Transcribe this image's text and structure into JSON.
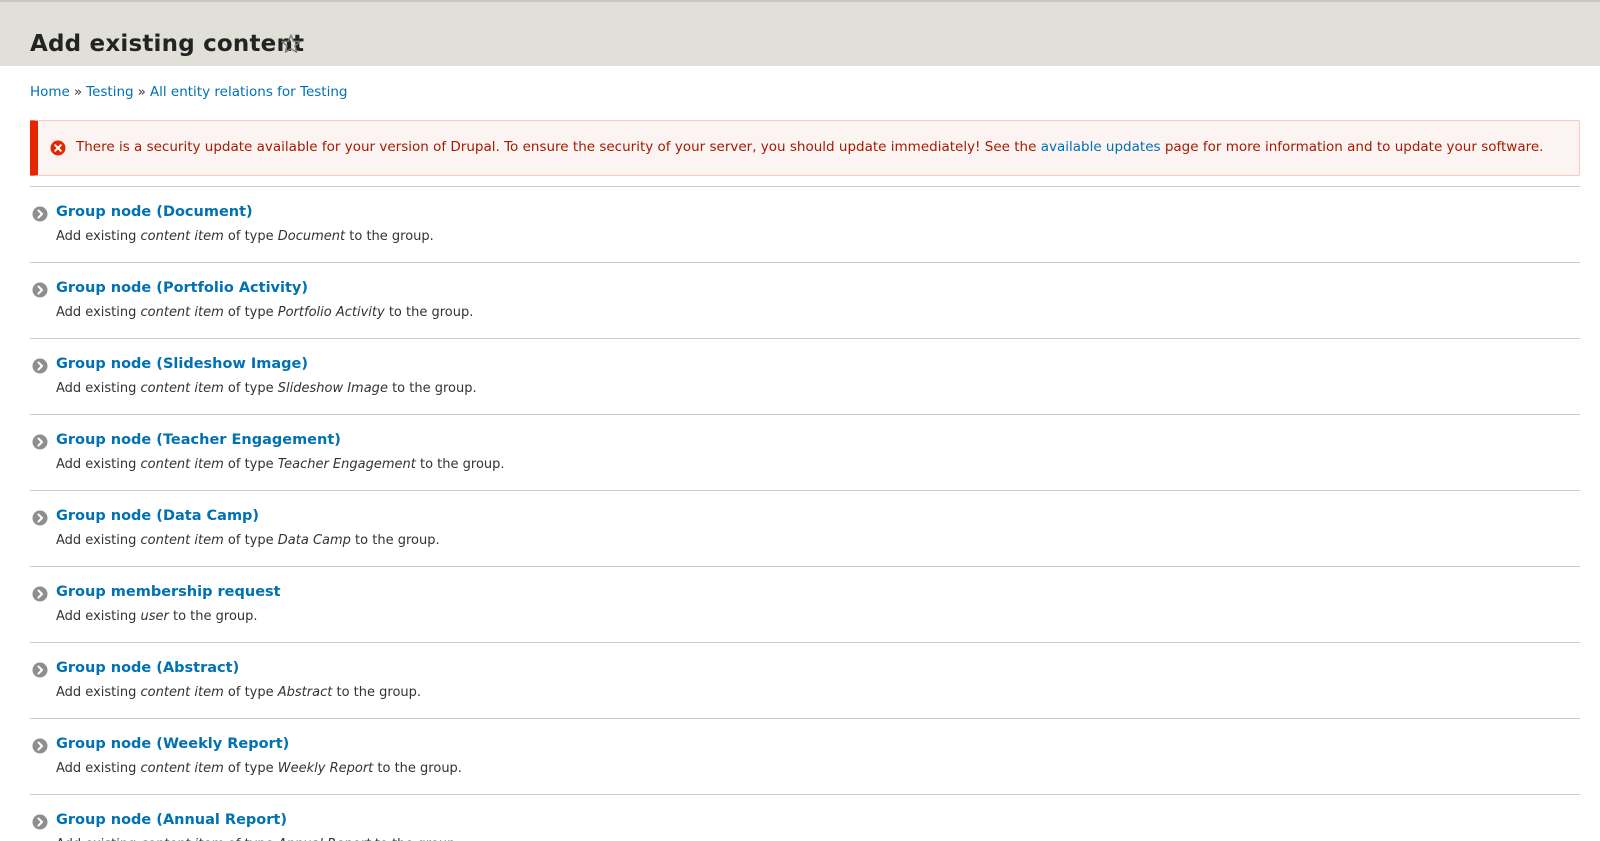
{
  "header": {
    "title": "Add existing content"
  },
  "breadcrumb": {
    "items": [
      "Home",
      "Testing",
      "All entity relations for Testing"
    ],
    "separator": "»"
  },
  "message": {
    "text_before": "There is a security update available for your version of Drupal. To ensure the security of your server, you should update immediately! See the",
    "link_text": "available updates",
    "text_after": "page for more information and to update your software."
  },
  "items": [
    {
      "title": "Group node (Document)",
      "prefix": "Add existing",
      "entity": "content item",
      "of_type": "of type",
      "type": "Document",
      "suffix": "to the group."
    },
    {
      "title": "Group node (Portfolio Activity)",
      "prefix": "Add existing",
      "entity": "content item",
      "of_type": "of type",
      "type": "Portfolio Activity",
      "suffix": "to the group."
    },
    {
      "title": "Group node (Slideshow Image)",
      "prefix": "Add existing",
      "entity": "content item",
      "of_type": "of type",
      "type": "Slideshow Image",
      "suffix": "to the group."
    },
    {
      "title": "Group node (Teacher Engagement)",
      "prefix": "Add existing",
      "entity": "content item",
      "of_type": "of type",
      "type": "Teacher Engagement",
      "suffix": "to the group."
    },
    {
      "title": "Group node (Data Camp)",
      "prefix": "Add existing",
      "entity": "content item",
      "of_type": "of type",
      "type": "Data Camp",
      "suffix": "to the group."
    },
    {
      "title": "Group membership request",
      "prefix": "Add existing",
      "entity": "user",
      "of_type": "",
      "type": "",
      "suffix": "to the group."
    },
    {
      "title": "Group node (Abstract)",
      "prefix": "Add existing",
      "entity": "content item",
      "of_type": "of type",
      "type": "Abstract",
      "suffix": "to the group."
    },
    {
      "title": "Group node (Weekly Report)",
      "prefix": "Add existing",
      "entity": "content item",
      "of_type": "of type",
      "type": "Weekly Report",
      "suffix": "to the group."
    },
    {
      "title": "Group node (Annual Report)",
      "prefix": "Add existing",
      "entity": "content item",
      "of_type": "of type",
      "type": "Annual Report",
      "suffix": "to the group."
    }
  ],
  "colors": {
    "link": "#0071b3",
    "error_text": "#a51b00",
    "error_accent": "#e62600",
    "header_bg": "#e0e0d8",
    "chevron_icon": "#8e8e8e"
  },
  "icons": {
    "shortcut": "star-outline-icon",
    "error": "error-circle-x-icon",
    "item": "chevron-right-circle-icon"
  }
}
